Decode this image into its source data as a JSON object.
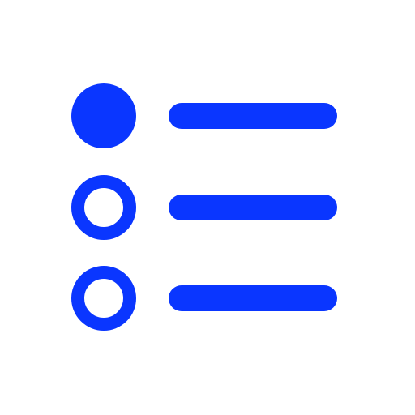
{
  "icon": {
    "name": "radio-list-icon",
    "color": "#0a36ff",
    "background": "#ffffff",
    "items": [
      {
        "selected": true
      },
      {
        "selected": false
      },
      {
        "selected": false
      }
    ]
  }
}
